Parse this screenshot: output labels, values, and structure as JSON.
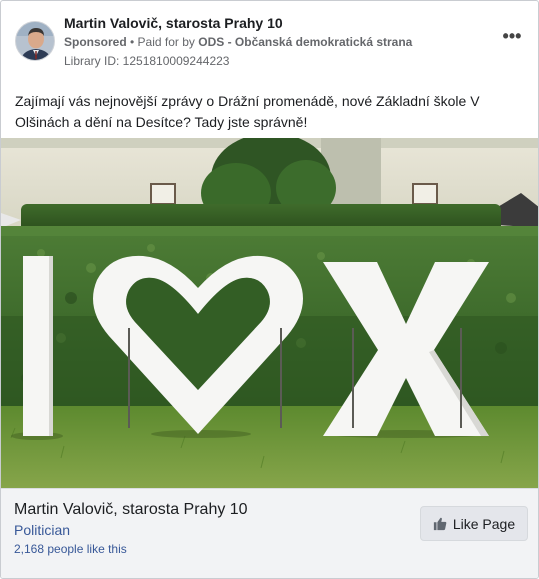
{
  "post": {
    "author": "Martin Valovič, starosta Prahy 10",
    "sponsored_label": "Sponsored",
    "paid_prefix": " • Paid for by ",
    "payer": "ODS - Občanská demokratická strana",
    "library_id": "Library ID: 1251810009244223",
    "more_label": "•••",
    "message": "Zajímají vás nejnovější zprávy o Drážní promenádě, nové Základní škole V Olšinách a dění na Desítce? Tady jste správně!"
  },
  "footer": {
    "page_name": "Martin Valovič, starosta Prahy 10",
    "category": "Politician",
    "likes": "2,168 people like this",
    "like_button_label": "Like Page"
  },
  "icons": {
    "avatar": "avatar",
    "more": "more-options-icon",
    "like": "thumbs-up-icon"
  }
}
